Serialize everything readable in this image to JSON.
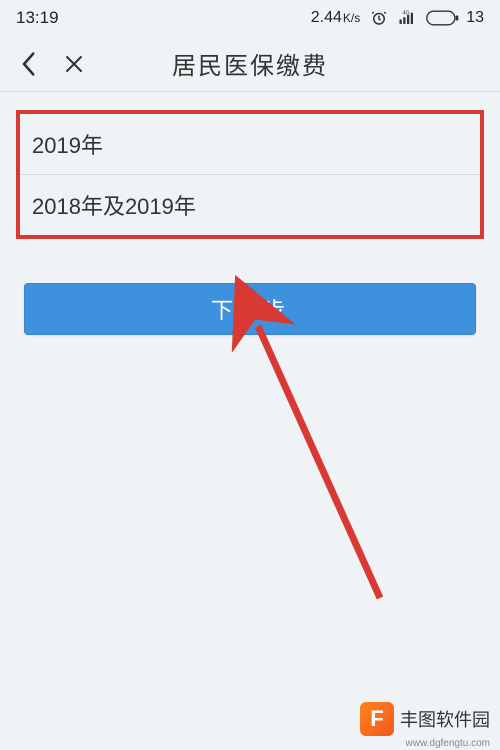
{
  "status": {
    "time": "13:19",
    "data_rate_value": "2.44",
    "data_rate_unit": "K/s",
    "battery": "13"
  },
  "nav": {
    "title": "居民医保缴费"
  },
  "options": {
    "items": [
      {
        "label": "2019年"
      },
      {
        "label": "2018年及2019年"
      }
    ]
  },
  "action": {
    "primary": "下一步"
  },
  "watermark": {
    "logo_letter": "F",
    "text": "丰图软件园",
    "url": "www.dgfengtu.com"
  }
}
